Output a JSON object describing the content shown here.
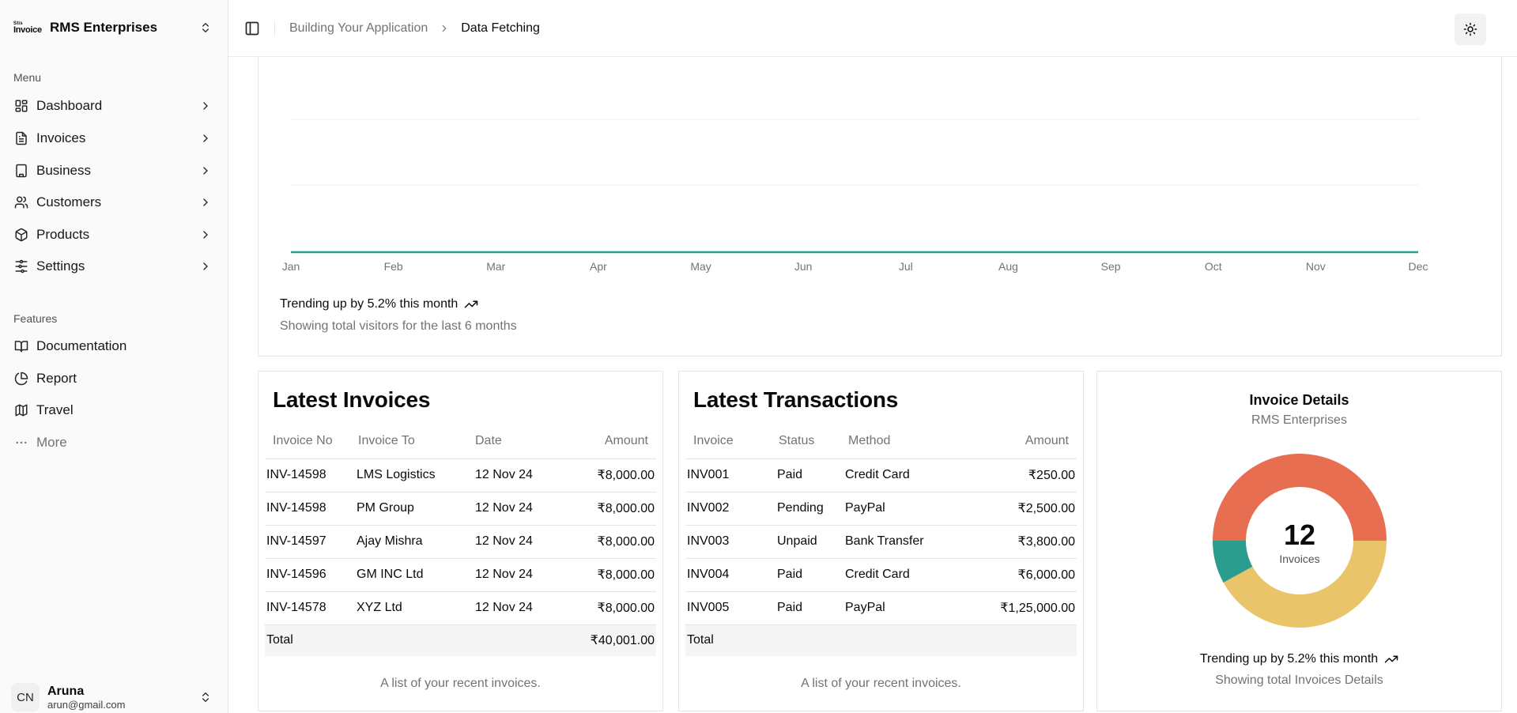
{
  "sidebar": {
    "brand": {
      "logo_top": "Stis",
      "logo_bottom": "Invoice",
      "name": "RMS Enterprises"
    },
    "menu_label": "Menu",
    "menu_items": [
      {
        "label": "Dashboard",
        "icon": "dashboard-icon"
      },
      {
        "label": "Invoices",
        "icon": "file-text-icon"
      },
      {
        "label": "Business",
        "icon": "building-icon"
      },
      {
        "label": "Customers",
        "icon": "users-icon"
      },
      {
        "label": "Products",
        "icon": "package-icon"
      },
      {
        "label": "Settings",
        "icon": "settings-icon"
      }
    ],
    "features_label": "Features",
    "feature_items": [
      {
        "label": "Documentation",
        "icon": "book-icon"
      },
      {
        "label": "Report",
        "icon": "pie-chart-icon"
      },
      {
        "label": "Travel",
        "icon": "map-icon"
      },
      {
        "label": "More",
        "icon": "more-horizontal-icon"
      }
    ],
    "user": {
      "initials": "CN",
      "name": "Aruna",
      "email": "arun@gmail.com"
    }
  },
  "header": {
    "breadcrumb": [
      "Building Your Application",
      "Data Fetching"
    ]
  },
  "chart_data": {
    "type": "line",
    "categories": [
      "Jan",
      "Feb",
      "Mar",
      "Apr",
      "May",
      "Jun",
      "Jul",
      "Aug",
      "Sep",
      "Oct",
      "Nov",
      "Dec"
    ],
    "series": [
      {
        "values": [
          0,
          0,
          0,
          0,
          0,
          0,
          0,
          0,
          0,
          0,
          0,
          0
        ],
        "color": "#2a9d8f"
      }
    ],
    "grid": true
  },
  "chart_footer": {
    "trend": "Trending up by 5.2% this month",
    "subtitle": "Showing total visitors for the last 6 months"
  },
  "latest_invoices": {
    "title": "Latest Invoices",
    "columns": [
      "Invoice No",
      "Invoice To",
      "Date",
      "Amount"
    ],
    "rows": [
      [
        "INV-14598",
        "LMS Logistics",
        "12 Nov 24",
        "₹8,000.00"
      ],
      [
        "INV-14598",
        "PM Group",
        "12 Nov 24",
        "₹8,000.00"
      ],
      [
        "INV-14597",
        "Ajay Mishra",
        "12 Nov 24",
        "₹8,000.00"
      ],
      [
        "INV-14596",
        "GM INC Ltd",
        "12 Nov 24",
        "₹8,000.00"
      ],
      [
        "INV-14578",
        "XYZ Ltd",
        "12 Nov 24",
        "₹8,000.00"
      ]
    ],
    "total_label": "Total",
    "total_value": "₹40,001.00",
    "caption": "A list of your recent invoices."
  },
  "latest_transactions": {
    "title": "Latest Transactions",
    "columns": [
      "Invoice",
      "Status",
      "Method",
      "Amount"
    ],
    "rows": [
      [
        "INV001",
        "Paid",
        "Credit Card",
        "₹250.00"
      ],
      [
        "INV002",
        "Pending",
        "PayPal",
        "₹2,500.00"
      ],
      [
        "INV003",
        "Unpaid",
        "Bank Transfer",
        "₹3,800.00"
      ],
      [
        "INV004",
        "Paid",
        "Credit Card",
        "₹6,000.00"
      ],
      [
        "INV005",
        "Paid",
        "PayPal",
        "₹1,25,000.00"
      ]
    ],
    "total_label": "Total",
    "caption": "A list of your recent invoices."
  },
  "invoice_details": {
    "title": "Invoice Details",
    "subtitle": "RMS Enterprises",
    "center_value": "12",
    "center_label": "Invoices",
    "donut": {
      "type": "pie",
      "slices": [
        {
          "share": 0.5,
          "color": "#e76e50"
        },
        {
          "share": 0.42,
          "color": "#e9c46a"
        },
        {
          "share": 0.08,
          "color": "#2a9d8f"
        }
      ]
    },
    "trend": "Trending up by 5.2% this month",
    "footer": "Showing total Invoices Details"
  },
  "colors": {
    "teal": "#2a9d8f",
    "orange": "#e76e50",
    "yellow": "#e9c46a"
  }
}
